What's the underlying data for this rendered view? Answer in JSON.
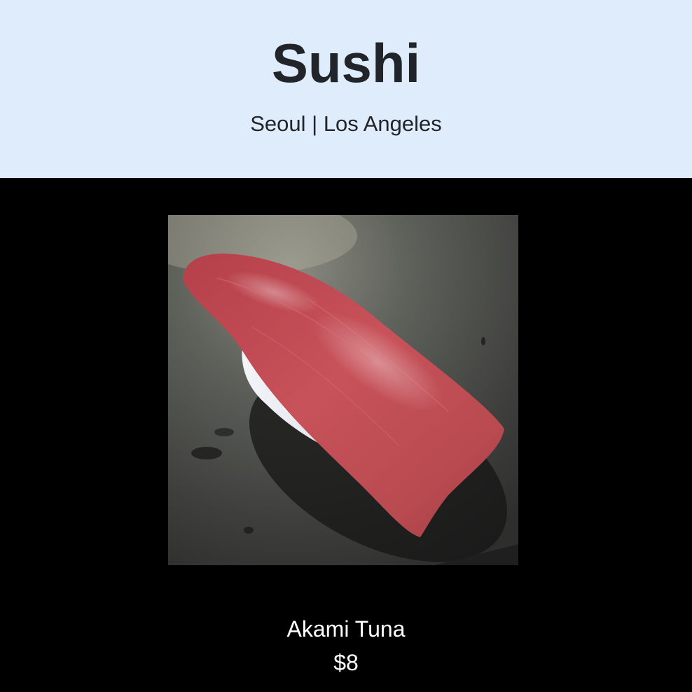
{
  "header": {
    "title": "Sushi",
    "subtitle": "Seoul | Los Angeles"
  },
  "item": {
    "photo_alt": "Akami Tuna nigiri",
    "name": "Akami Tuna",
    "price": "$8"
  },
  "colors": {
    "header_bg": "#deecfb",
    "page_bg": "#000000",
    "heading_text": "#212529",
    "item_text": "#ffffff"
  }
}
